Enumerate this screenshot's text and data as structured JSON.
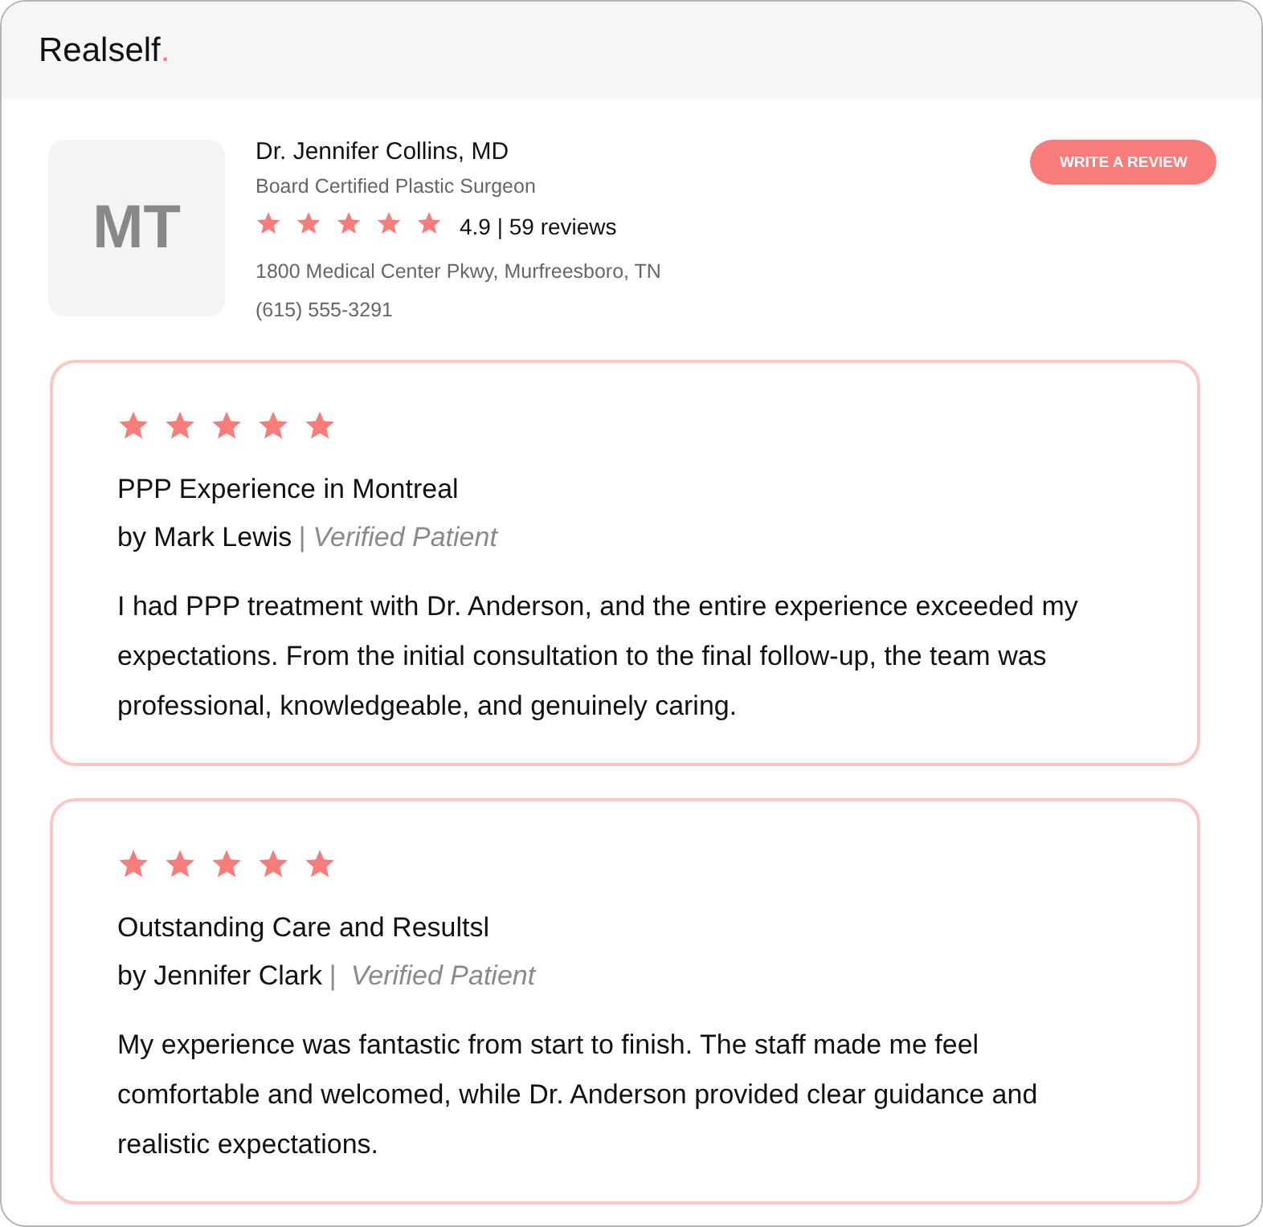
{
  "logo": {
    "name": "Realself",
    "dot": "."
  },
  "doctor": {
    "initials": "MT",
    "name": "Dr. Jennifer Collins, MD",
    "specialty": "Board Certified Plastic Surgeon",
    "stars": 5,
    "rating": "4.9 | 59 reviews",
    "address": "1800 Medical Center Pkwy, Murfreesboro, TN",
    "phone": "(615) 555-3291"
  },
  "write_review_button": "WRITE A REVIEW",
  "reviews": [
    {
      "stars": 5,
      "title": "PPP Experience in Montreal",
      "author": "by Mark Lewis",
      "verified": "| Verified Patient",
      "body": "I had PPP treatment with Dr. Anderson, and the entire experience exceeded my expectations. From the initial consultation to the final follow-up, the team was professional, knowledgeable, and genuinely caring."
    },
    {
      "stars": 5,
      "title": "Outstanding Care and Resultsl",
      "author": "by Jennifer Clark",
      "verified": "|  Verified Patient",
      "body": "My experience was fantastic from start to finish. The staff made me feel comfortable and welcomed, while Dr. Anderson provided clear guidance and realistic expectations."
    }
  ]
}
